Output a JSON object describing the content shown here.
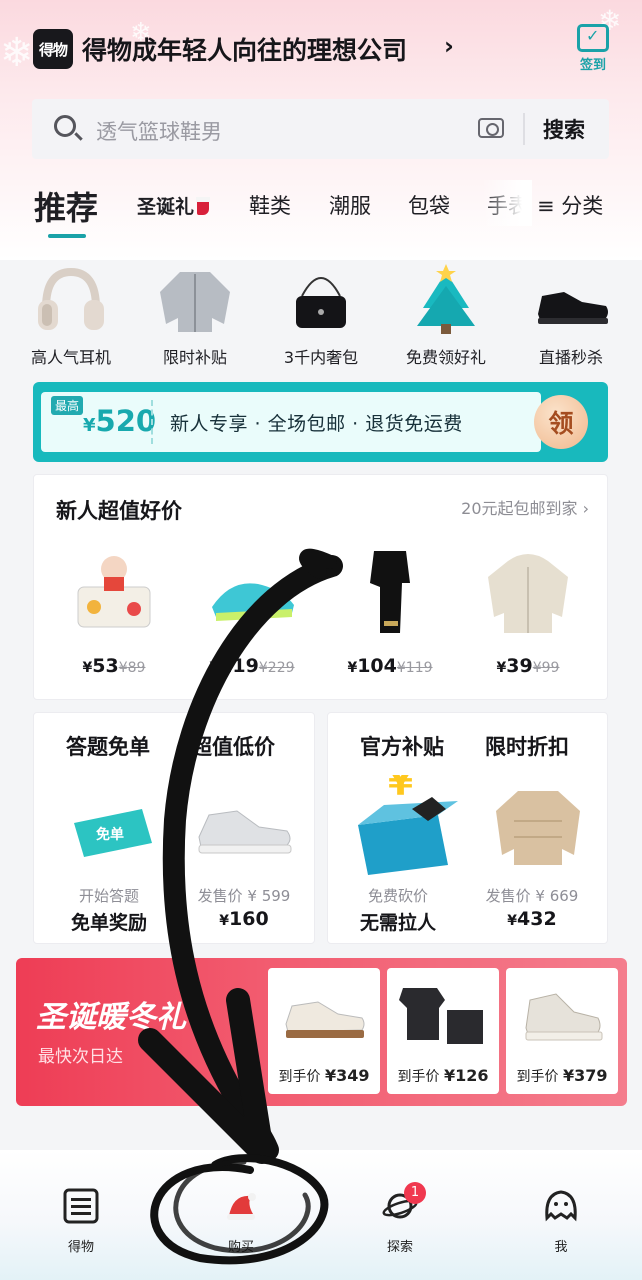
{
  "header": {
    "logo_text": "得物",
    "title": "得物成年轻人向往的理想公司",
    "title_arrow": "›",
    "signin_label": "签到"
  },
  "search": {
    "placeholder": "透气篮球鞋男",
    "button_label": "搜索"
  },
  "tabs": {
    "items": [
      "推荐",
      "圣诞礼",
      "鞋类",
      "潮服",
      "包袋",
      "手表"
    ],
    "active": "推荐",
    "category_label": "≡ 分类"
  },
  "categories": [
    {
      "label": "高人气耳机",
      "icon": "headphones-icon"
    },
    {
      "label": "限时补贴",
      "icon": "jacket-icon"
    },
    {
      "label": "3千内奢包",
      "icon": "handbag-icon"
    },
    {
      "label": "免费领好礼",
      "icon": "christmas-tree-icon"
    },
    {
      "label": "直播秒杀",
      "icon": "sneaker-icon"
    }
  ],
  "coupon": {
    "max_label": "最高",
    "currency": "¥",
    "amount": "520",
    "text": "新人专享 · 全场包邮 · 退货免运费",
    "claim_label": "领",
    "colors": {
      "accent": "#18b9bd",
      "claim": "#f0b88d"
    }
  },
  "newcomer": {
    "title": "新人超值好价",
    "link": "20元起包邮到家 ›",
    "products": [
      {
        "price": "53",
        "original": "89",
        "icon": "toy-figure-icon"
      },
      {
        "price": "219",
        "original": "229",
        "icon": "running-shoe-icon"
      },
      {
        "price": "104",
        "original": "119",
        "icon": "scarf-icon"
      },
      {
        "price": "39",
        "original": "99",
        "icon": "hoodie-icon"
      }
    ]
  },
  "features": [
    {
      "heading": "答题免单",
      "sub": "开始答题",
      "value": "免单奖励",
      "icon": "free-ticket-icon",
      "ticket_text": "免单"
    },
    {
      "heading": "超值低价",
      "sub": "发售价 ¥ 599",
      "value": "160",
      "icon": "sneaker-icon"
    },
    {
      "heading": "官方补贴",
      "sub": "免费砍价",
      "value": "无需拉人",
      "icon": "gift-box-icon"
    },
    {
      "heading": "限时折扣",
      "sub": "发售价 ¥ 669",
      "value": "432",
      "icon": "down-jacket-icon"
    }
  ],
  "xmas": {
    "title": "圣诞暖冬礼",
    "subtitle": "最快次日达",
    "price_prefix": "到手价",
    "products": [
      {
        "price": "¥349",
        "icon": "sneaker-icon"
      },
      {
        "price": "¥126",
        "icon": "pajama-set-icon"
      },
      {
        "price": "¥379",
        "icon": "sneaker-icon"
      }
    ]
  },
  "nav": {
    "items": [
      {
        "label": "得物",
        "icon": "home-logo-icon"
      },
      {
        "label": "购买",
        "icon": "santa-hat-icon"
      },
      {
        "label": "探索",
        "icon": "planet-icon",
        "badge": "1"
      },
      {
        "label": "我",
        "icon": "profile-icon"
      }
    ]
  },
  "currency_symbol": "¥"
}
